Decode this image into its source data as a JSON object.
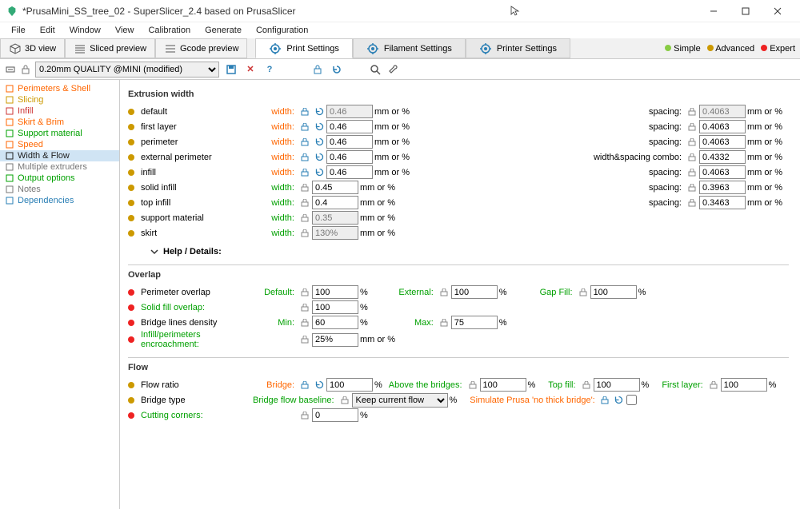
{
  "window": {
    "title": "*PrusaMini_SS_tree_02 - SuperSlicer_2.4  based on PrusaSlicer"
  },
  "menu": [
    "File",
    "Edit",
    "Window",
    "View",
    "Calibration",
    "Generate",
    "Configuration"
  ],
  "plater_tabs": [
    "3D view",
    "Sliced preview",
    "Gcode preview"
  ],
  "cfg_tabs": [
    "Print Settings",
    "Filament Settings",
    "Printer Settings"
  ],
  "expert_modes": {
    "simple": "Simple",
    "advanced": "Advanced",
    "expert": "Expert"
  },
  "preset": "0.20mm QUALITY @MINI (modified)",
  "sidebar": [
    {
      "label": "Perimeters & Shell",
      "color": "#ff6600",
      "icon": "ring"
    },
    {
      "label": "Slicing",
      "color": "#cc9900",
      "icon": "layers"
    },
    {
      "label": "Infill",
      "color": "#cc3333",
      "icon": "infill"
    },
    {
      "label": "Skirt & Brim",
      "color": "#ff6600",
      "icon": "brim"
    },
    {
      "label": "Support material",
      "color": "#00a000",
      "icon": "support"
    },
    {
      "label": "Speed",
      "color": "#ff6600",
      "icon": "speed"
    },
    {
      "label": "Width & Flow",
      "color": "#222",
      "icon": "width",
      "sel": true
    },
    {
      "label": "Multiple extruders",
      "color": "#777",
      "icon": "extruder"
    },
    {
      "label": "Output options",
      "color": "#00a000",
      "icon": "output"
    },
    {
      "label": "Notes",
      "color": "#777",
      "icon": "notes"
    },
    {
      "label": "Dependencies",
      "color": "#2a7fb5",
      "icon": "dep"
    }
  ],
  "sections": {
    "extrusion": {
      "title": "Extrusion width",
      "rows": [
        {
          "name": "default",
          "width": "0.46",
          "width_ro": true,
          "spacing": "0.4063",
          "spacing_ro": true,
          "bullet": "#cc9900",
          "width_lbl": "#ff6600",
          "reset": true
        },
        {
          "name": "first layer",
          "width": "0.46",
          "spacing": "0.4063",
          "bullet": "#cc9900",
          "width_lbl": "#ff6600",
          "reset": true
        },
        {
          "name": "perimeter",
          "width": "0.46",
          "spacing": "0.4063",
          "bullet": "#cc9900",
          "width_lbl": "#ff6600",
          "reset": true
        },
        {
          "name": "external perimeter",
          "width": "0.46",
          "spacing": "0.4332",
          "spacing_lbl": "width&spacing combo:",
          "bullet": "#cc9900",
          "width_lbl": "#ff6600",
          "reset": true
        },
        {
          "name": "infill",
          "width": "0.46",
          "spacing": "0.4063",
          "bullet": "#cc9900",
          "width_lbl": "#ff6600",
          "reset": true
        },
        {
          "name": "solid infill",
          "width": "0.45",
          "spacing": "0.3963",
          "bullet": "#cc9900",
          "width_lbl": "#00a000"
        },
        {
          "name": "top infill",
          "width": "0.4",
          "spacing": "0.3463",
          "bullet": "#cc9900",
          "width_lbl": "#00a000"
        },
        {
          "name": "support material",
          "width": "0.35",
          "width_ro": true,
          "bullet": "#cc9900",
          "width_lbl": "#00a000"
        },
        {
          "name": "skirt",
          "width": "130%",
          "width_ro": true,
          "bullet": "#cc9900",
          "width_lbl": "#00a000"
        }
      ],
      "labels": {
        "width": "width:",
        "spacing": "spacing:",
        "unit": "mm or %",
        "help": "Help / Details:"
      }
    },
    "overlap": {
      "title": "Overlap",
      "perimeter": {
        "label": "Perimeter overlap",
        "default": "100",
        "external": "100",
        "gapfill": "100",
        "pct": "%"
      },
      "solidfill": {
        "label": "Solid fill overlap:",
        "value": "100",
        "pct": "%"
      },
      "bridge": {
        "label": "Bridge lines density",
        "min": "60",
        "max": "75",
        "pct": "%"
      },
      "encroach": {
        "label": "Infill/perimeters encroachment:",
        "value": "25%",
        "unit": "mm or %"
      },
      "labels": {
        "default": "Default:",
        "external": "External:",
        "gapfill": "Gap Fill:",
        "min": "Min:",
        "max": "Max:"
      }
    },
    "flow": {
      "title": "Flow",
      "ratio": {
        "label": "Flow ratio",
        "bridge": "100",
        "above": "100",
        "topfill": "100",
        "firstlayer": "100",
        "pct": "%"
      },
      "bridge_type": {
        "label": "Bridge type",
        "baseline": "Bridge flow baseline:",
        "value": "Keep current flow",
        "pct": "%",
        "simulate": "Simulate Prusa 'no thick bridge':"
      },
      "cutting": {
        "label": "Cutting corners:",
        "value": "0",
        "pct": "%"
      },
      "labels": {
        "bridge": "Bridge:",
        "above": "Above the bridges:",
        "topfill": "Top fill:",
        "firstlayer": "First layer:"
      }
    }
  }
}
